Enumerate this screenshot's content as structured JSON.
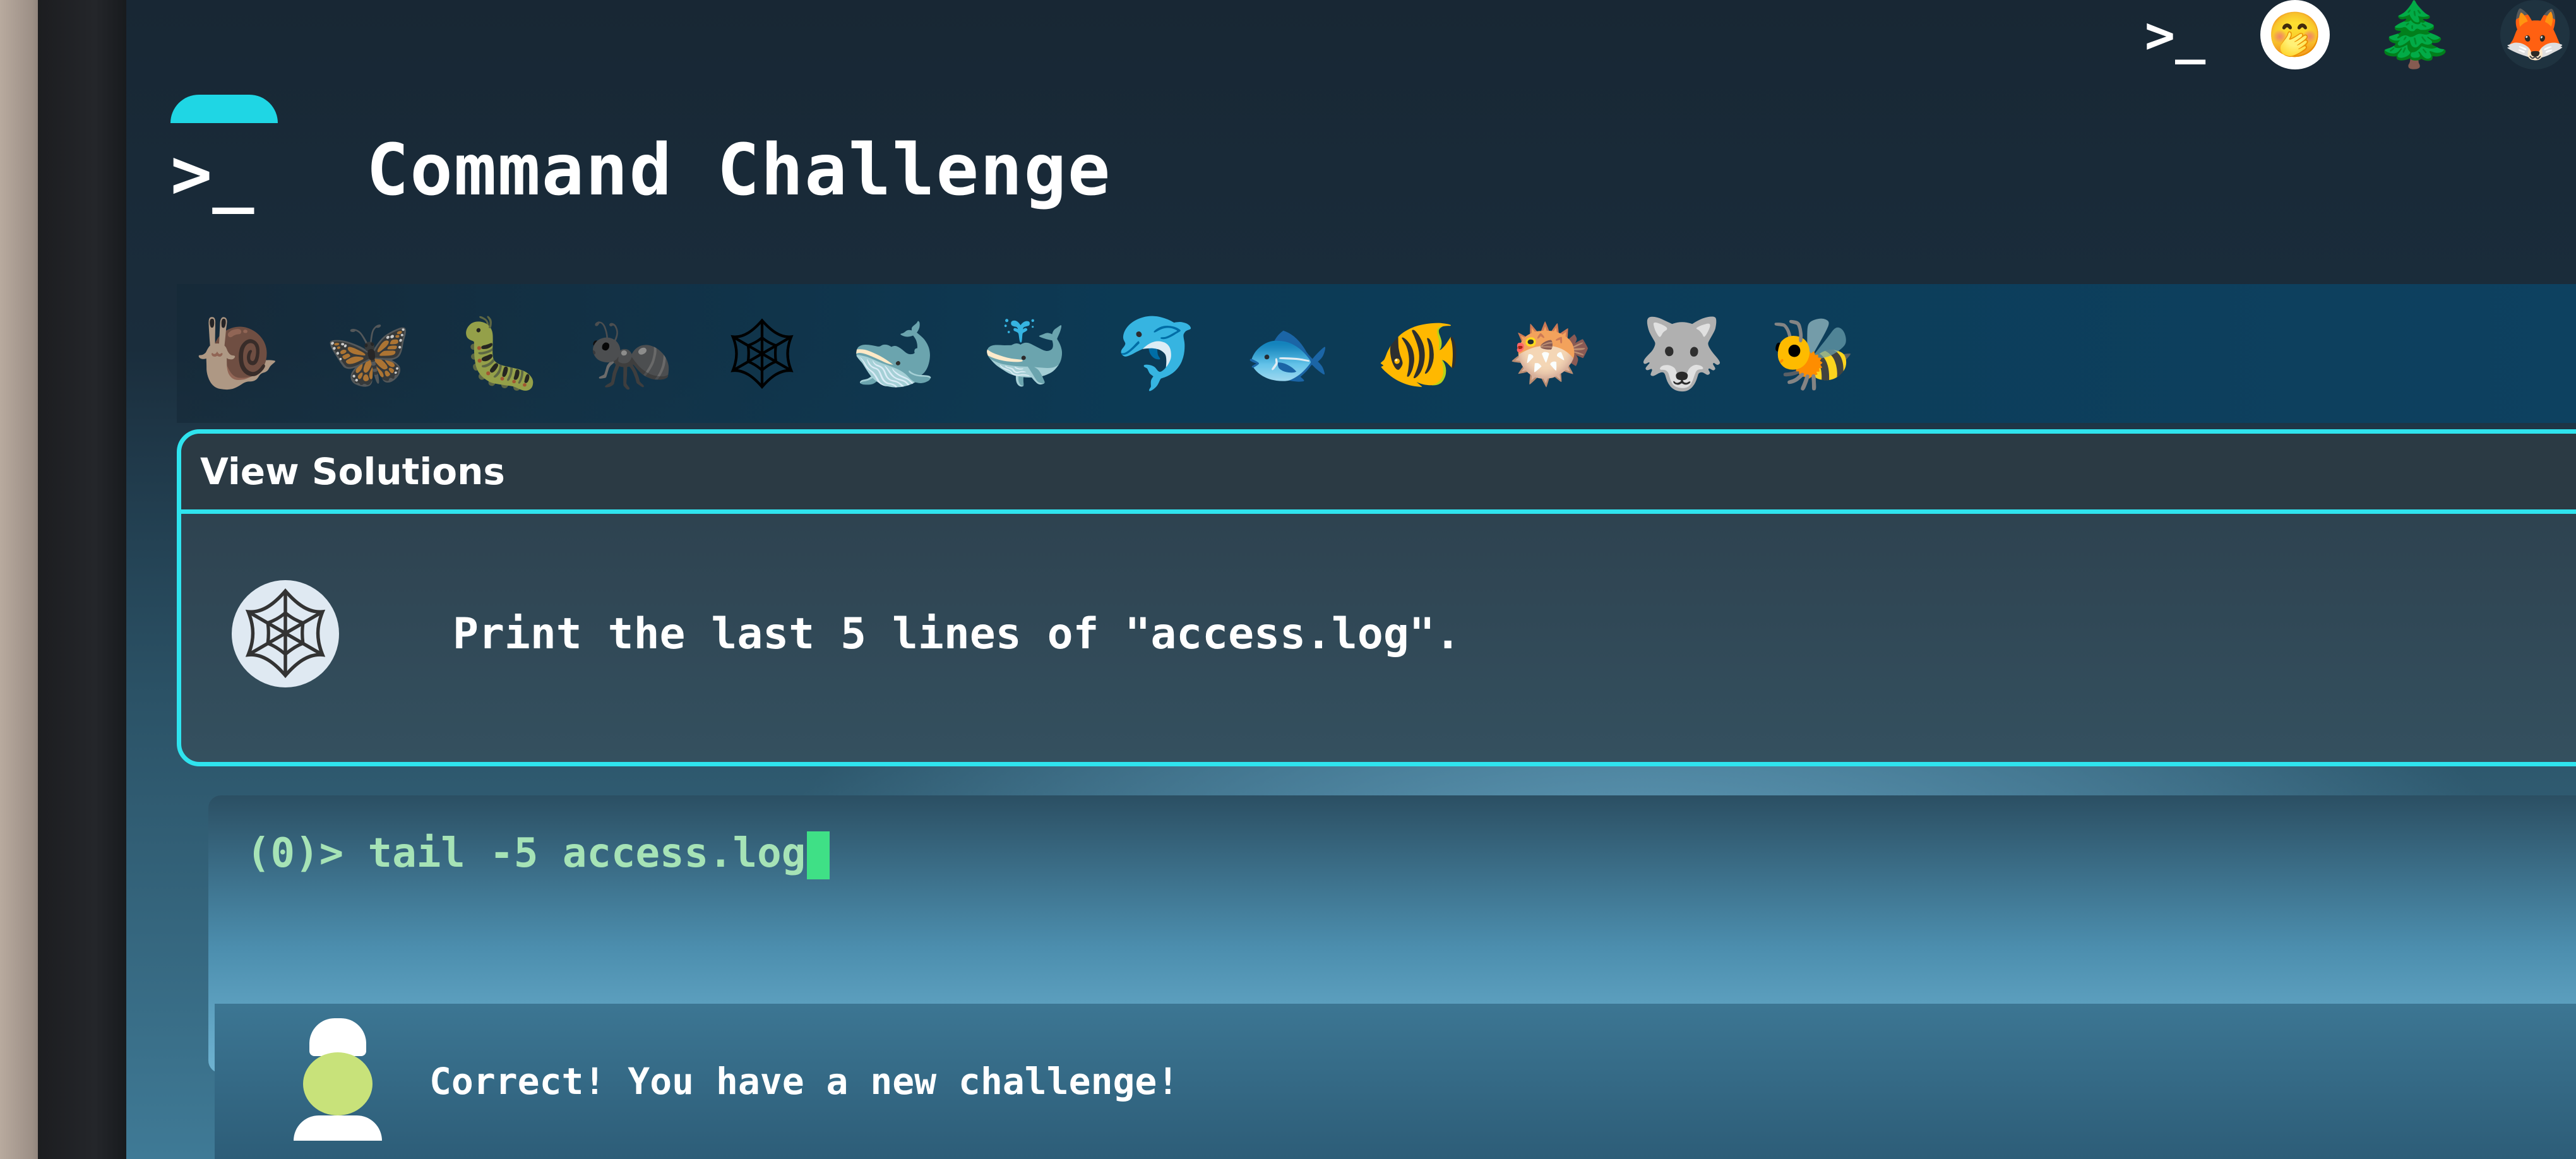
{
  "topbar": {
    "icons": [
      "terminal-icon",
      "shush-face-icon",
      "tree-icon",
      "gitlab-fox-icon"
    ],
    "terminal_glyph": ">_"
  },
  "header": {
    "logo_glyph": ">_",
    "title": "Command Challenge"
  },
  "animals": [
    {
      "name": "snail",
      "glyph": "🐌"
    },
    {
      "name": "butterfly",
      "glyph": "🦋"
    },
    {
      "name": "caterpillar",
      "glyph": "🐛"
    },
    {
      "name": "ant",
      "glyph": "🐜"
    },
    {
      "name": "spider-web",
      "glyph": "🕸"
    },
    {
      "name": "whale",
      "glyph": "🐋"
    },
    {
      "name": "whale-2",
      "glyph": "🐳"
    },
    {
      "name": "dolphin",
      "glyph": "🐬"
    },
    {
      "name": "fish",
      "glyph": "🐟"
    },
    {
      "name": "tropical-fish",
      "glyph": "🐠"
    },
    {
      "name": "pufferfish",
      "glyph": "🐡"
    },
    {
      "name": "wolf",
      "glyph": "🐺"
    },
    {
      "name": "bee",
      "glyph": "🐝"
    }
  ],
  "panel": {
    "header": "View Solutions",
    "task_icon": "spider-web-icon",
    "task_glyph": "🕸",
    "task": "Print the last 5 lines of \"access.log\"."
  },
  "console": {
    "prompt": "(0)> ",
    "command": "tail -5 access.log"
  },
  "feedback": {
    "avatar": "chef-icon",
    "message": "Correct! You have a new challenge!"
  },
  "colors": {
    "accent": "#2fe3ee",
    "prompt_text": "#a6e3b6",
    "cursor": "#3fe086"
  }
}
